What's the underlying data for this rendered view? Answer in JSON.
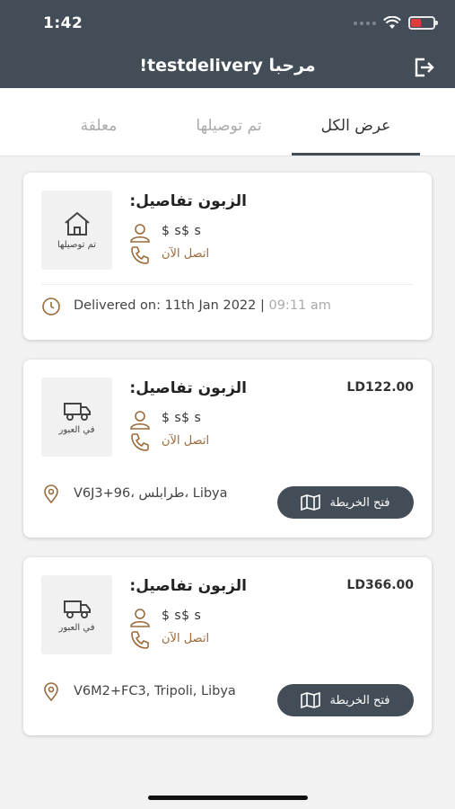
{
  "status_bar": {
    "time": "1:42"
  },
  "header": {
    "title": "مرحبا testdelivery!"
  },
  "tabs": [
    {
      "label": "عرض الكل"
    },
    {
      "label": "تم توصيلها"
    },
    {
      "label": "معلقة"
    }
  ],
  "orders": [
    {
      "status_label": "تم توصيلها",
      "customer_title": "الزبون تفاصيل:",
      "customer_name": "$ s$ s",
      "call_label": "اتصل الآن",
      "delivered_prefix": "Delivered on: 11th Jan 2022 | ",
      "delivered_time": "09:11 am"
    },
    {
      "status_label": "في العبور",
      "customer_title": "الزبون تفاصيل:",
      "customer_name": "$ s$ s",
      "call_label": "اتصل الآن",
      "price": "LD122.00",
      "address": "V6J3+96، طرابلس، Libya",
      "map_button": "فتح الخريطة"
    },
    {
      "status_label": "في العبور",
      "customer_title": "الزبون تفاصيل:",
      "customer_name": "$ s$ s",
      "call_label": "اتصل الآن",
      "price": "LD366.00",
      "address": "V6M2+FC3, Tripoli, Libya",
      "map_button": "فتح الخريطة"
    }
  ],
  "colors": {
    "header_bg": "#434d57",
    "accent_brown": "#9a6a3a",
    "battery_low": "#e23b3b"
  }
}
